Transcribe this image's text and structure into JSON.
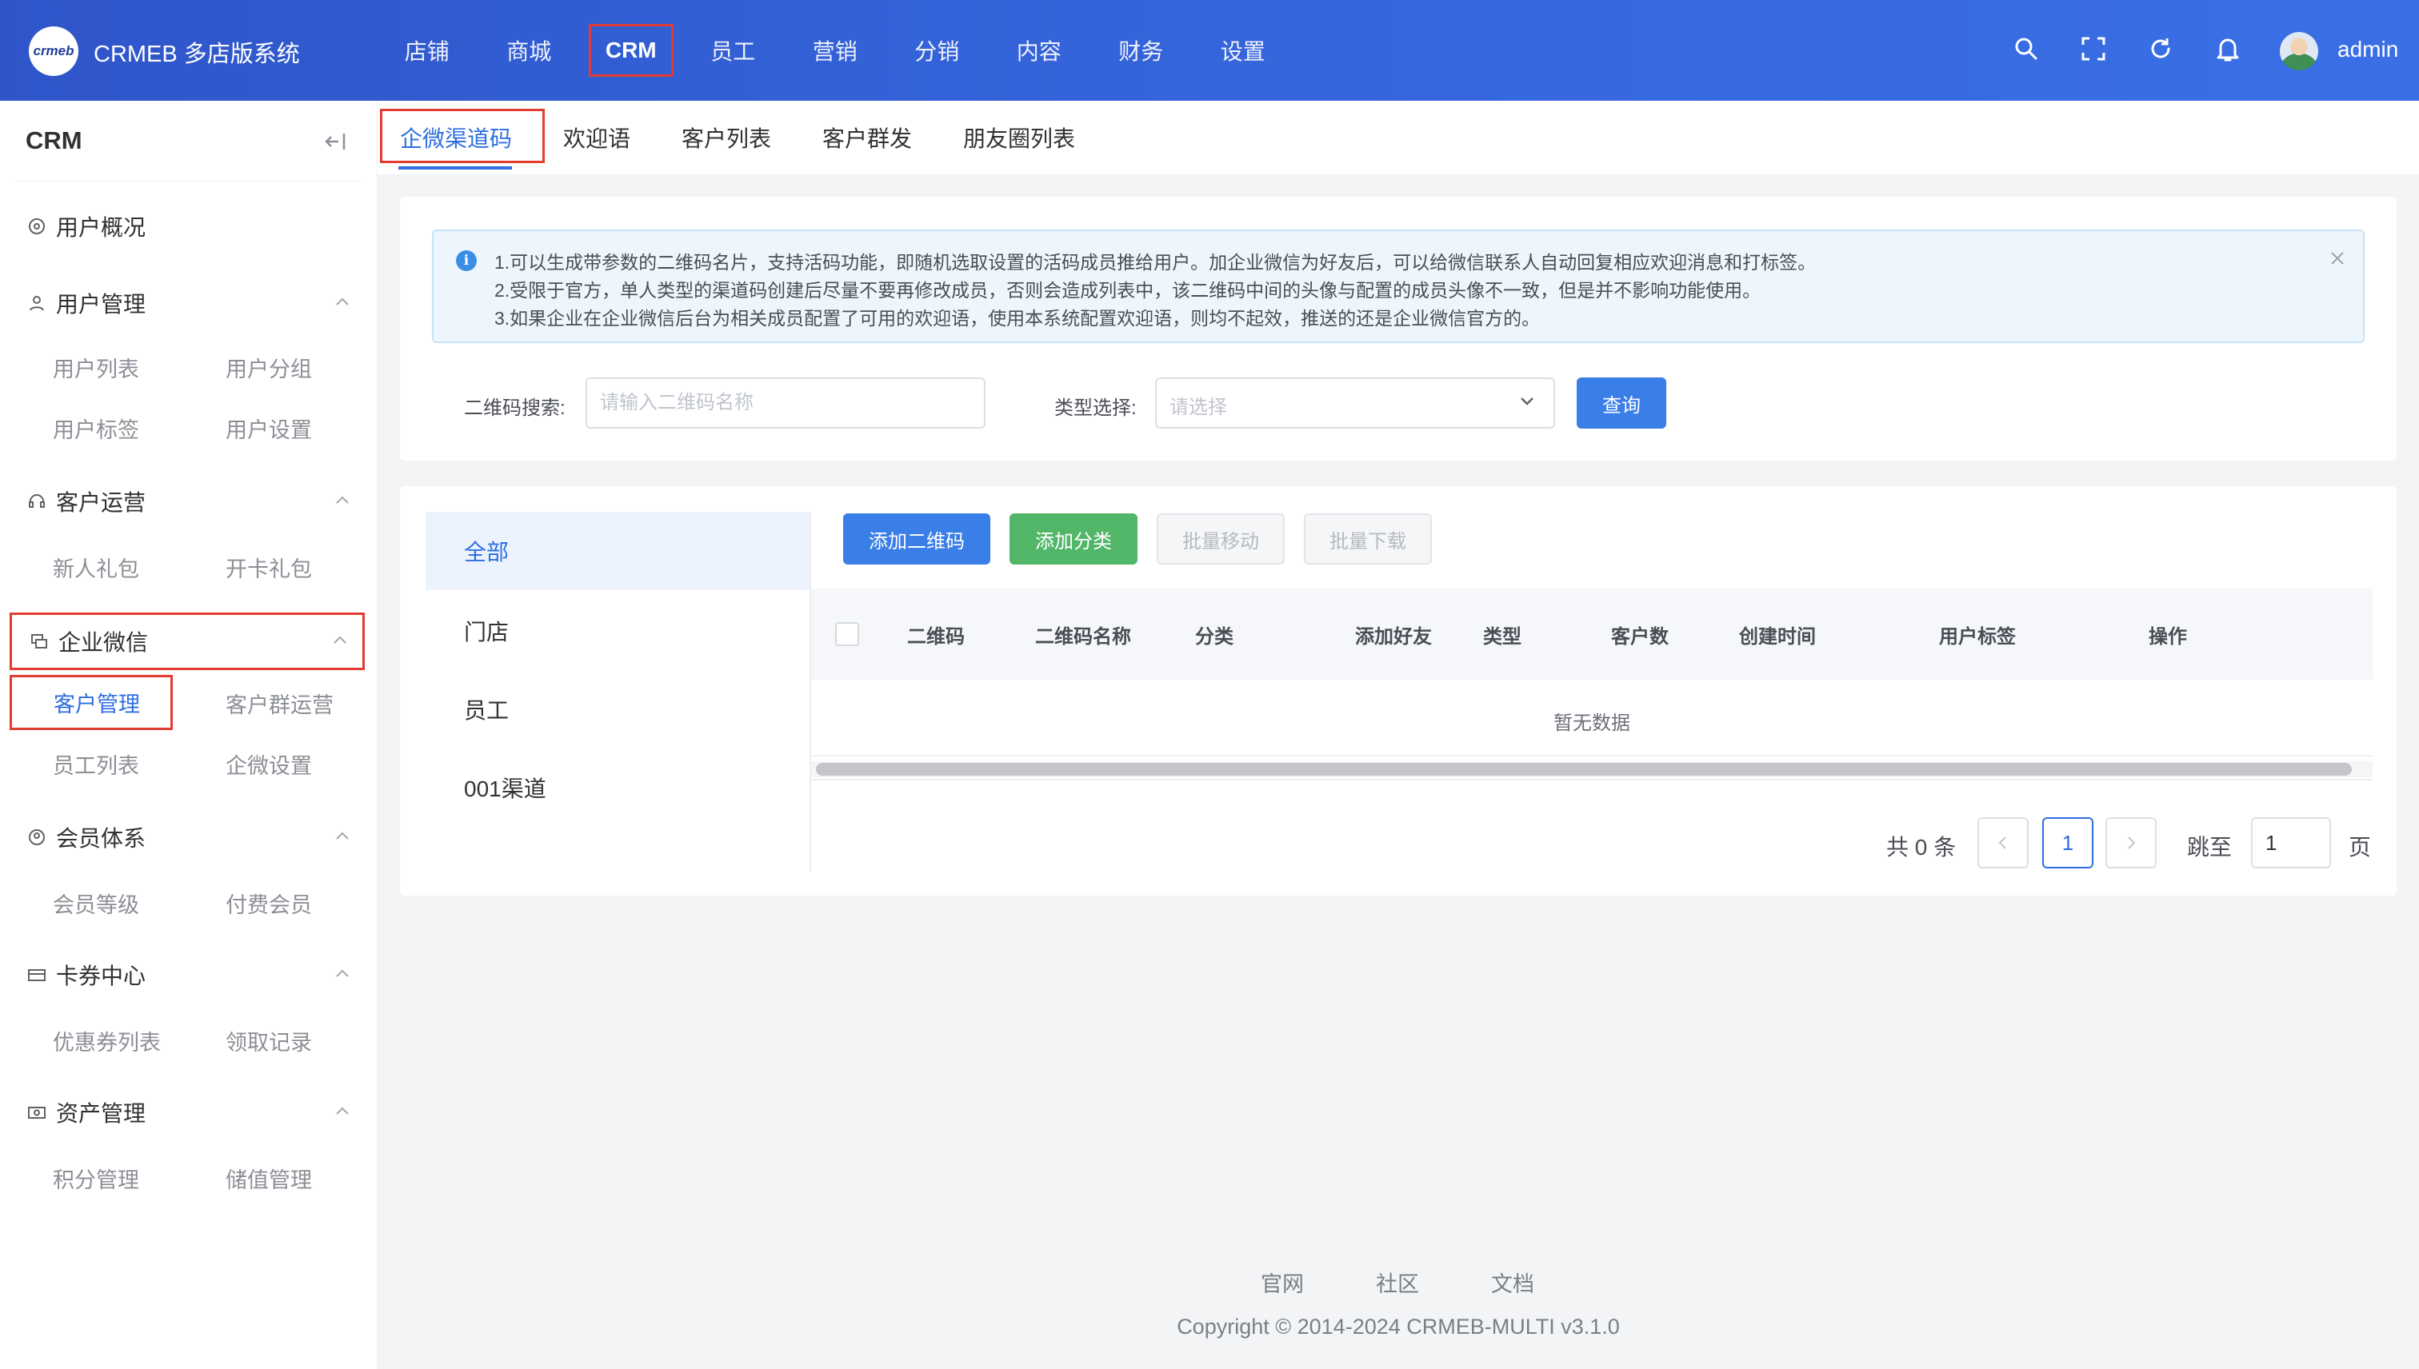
{
  "header": {
    "app_title": "CRMEB 多店版系统",
    "logo_text": "crmeb",
    "nav": [
      "店铺",
      "商城",
      "CRM",
      "员工",
      "营销",
      "分销",
      "内容",
      "财务",
      "设置"
    ],
    "active_nav": "CRM",
    "icons": [
      "search-icon",
      "fullscreen-icon",
      "refresh-icon",
      "bell-icon"
    ],
    "username": "admin",
    "brand_color": "#3564da"
  },
  "sidebar": {
    "title": "CRM",
    "groups": [
      {
        "label": "用户概况",
        "icon": "dashboard-icon",
        "items": []
      },
      {
        "label": "用户管理",
        "icon": "user-icon",
        "items": [
          "用户列表",
          "用户分组",
          "用户标签",
          "用户设置"
        ]
      },
      {
        "label": "客户运营",
        "icon": "headset-icon",
        "items": [
          "新人礼包",
          "开卡礼包"
        ]
      },
      {
        "label": "企业微信",
        "icon": "chat-icon",
        "items": [
          "客户管理",
          "客户群运营",
          "员工列表",
          "企微设置"
        ]
      },
      {
        "label": "会员体系",
        "icon": "member-icon",
        "items": [
          "会员等级",
          "付费会员"
        ]
      },
      {
        "label": "卡券中心",
        "icon": "card-icon",
        "items": [
          "优惠券列表",
          "领取记录"
        ]
      },
      {
        "label": "资产管理",
        "icon": "wallet-icon",
        "items": [
          "积分管理",
          "储值管理"
        ]
      }
    ],
    "active_item": "客户管理"
  },
  "tabs": {
    "items": [
      "企微渠道码",
      "欢迎语",
      "客户列表",
      "客户群发",
      "朋友圈列表"
    ],
    "active": "企微渠道码"
  },
  "notice": {
    "lines": [
      "1.可以生成带参数的二维码名片，支持活码功能，即随机选取设置的活码成员推给用户。加企业微信为好友后，可以给微信联系人自动回复相应欢迎消息和打标签。",
      "2.受限于官方，单人类型的渠道码创建后尽量不要再修改成员，否则会造成列表中，该二维码中间的头像与配置的成员头像不一致，但是并不影响功能使用。",
      "3.如果企业在企业微信后台为相关成员配置了可用的欢迎语，使用本系统配置欢迎语，则均不起效，推送的还是企业微信官方的。"
    ]
  },
  "search": {
    "qr_label": "二维码搜索:",
    "qr_placeholder": "请输入二维码名称",
    "qr_value": "",
    "type_label": "类型选择:",
    "type_placeholder": "请选择",
    "query_button": "查询"
  },
  "categories": [
    "全部",
    "门店",
    "员工",
    "001渠道"
  ],
  "active_category": "全部",
  "actions": {
    "add_qr": "添加二维码",
    "add_category": "添加分类",
    "batch_move": "批量移动",
    "batch_download": "批量下载"
  },
  "table": {
    "columns": [
      "二维码",
      "二维码名称",
      "分类",
      "添加好友",
      "类型",
      "客户数",
      "创建时间",
      "用户标签",
      "操作"
    ],
    "rows": [],
    "empty_text": "暂无数据"
  },
  "pagination": {
    "total_text": "共 0 条",
    "current_page": "1",
    "jump_label": "跳至",
    "jump_value": "1",
    "page_suffix": "页"
  },
  "footer": {
    "links": [
      "官网",
      "社区",
      "文档"
    ],
    "copyright": "Copyright © 2014-2024 CRMEB-MULTI v3.1.0"
  }
}
